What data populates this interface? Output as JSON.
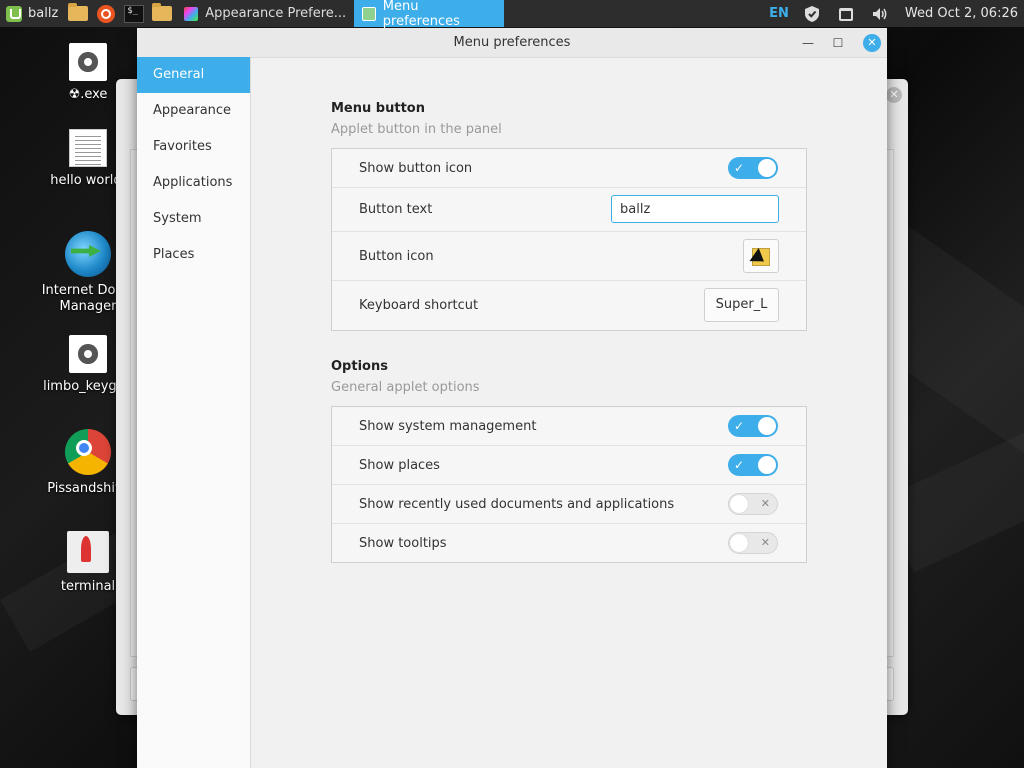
{
  "taskbar": {
    "menu_label": "ballz",
    "windows": [
      {
        "label": "Appearance Prefere...",
        "active": false
      },
      {
        "label": "Menu preferences",
        "active": true
      }
    ],
    "language": "EN",
    "clock": "Wed Oct  2, 06:26"
  },
  "desktop": {
    "icons": [
      {
        "label": "☢.exe",
        "icon": "gear-icon"
      },
      {
        "label": "hello world.",
        "icon": "text-document-icon"
      },
      {
        "label": "Internet Down Manager",
        "icon": "idm-icon"
      },
      {
        "label": "limbo_keygen",
        "icon": "gear-icon"
      },
      {
        "label": "Pissandshitti",
        "icon": "chrome-icon"
      },
      {
        "label": "terminal",
        "icon": "rocket-icon"
      }
    ]
  },
  "window": {
    "title": "Menu preferences",
    "sidebar": [
      "General",
      "Appearance",
      "Favorites",
      "Applications",
      "System",
      "Places"
    ],
    "active_sidebar": "General",
    "sections": [
      {
        "title": "Menu button",
        "subtitle": "Applet button in the panel",
        "rows": [
          {
            "label": "Show button icon",
            "type": "switch",
            "on": true
          },
          {
            "label": "Button text",
            "type": "text",
            "value": "ballz"
          },
          {
            "label": "Button icon",
            "type": "icon"
          },
          {
            "label": "Keyboard shortcut",
            "type": "keybinding",
            "value": "Super_L"
          }
        ]
      },
      {
        "title": "Options",
        "subtitle": "General applet options",
        "rows": [
          {
            "label": "Show system management",
            "type": "switch",
            "on": true
          },
          {
            "label": "Show places",
            "type": "switch",
            "on": true
          },
          {
            "label": "Show recently used documents and applications",
            "type": "switch",
            "on": false
          },
          {
            "label": "Show tooltips",
            "type": "switch",
            "on": false
          }
        ]
      }
    ]
  },
  "colors": {
    "accent": "#3daee9",
    "taskbar_bg": "#2d2d2d"
  }
}
